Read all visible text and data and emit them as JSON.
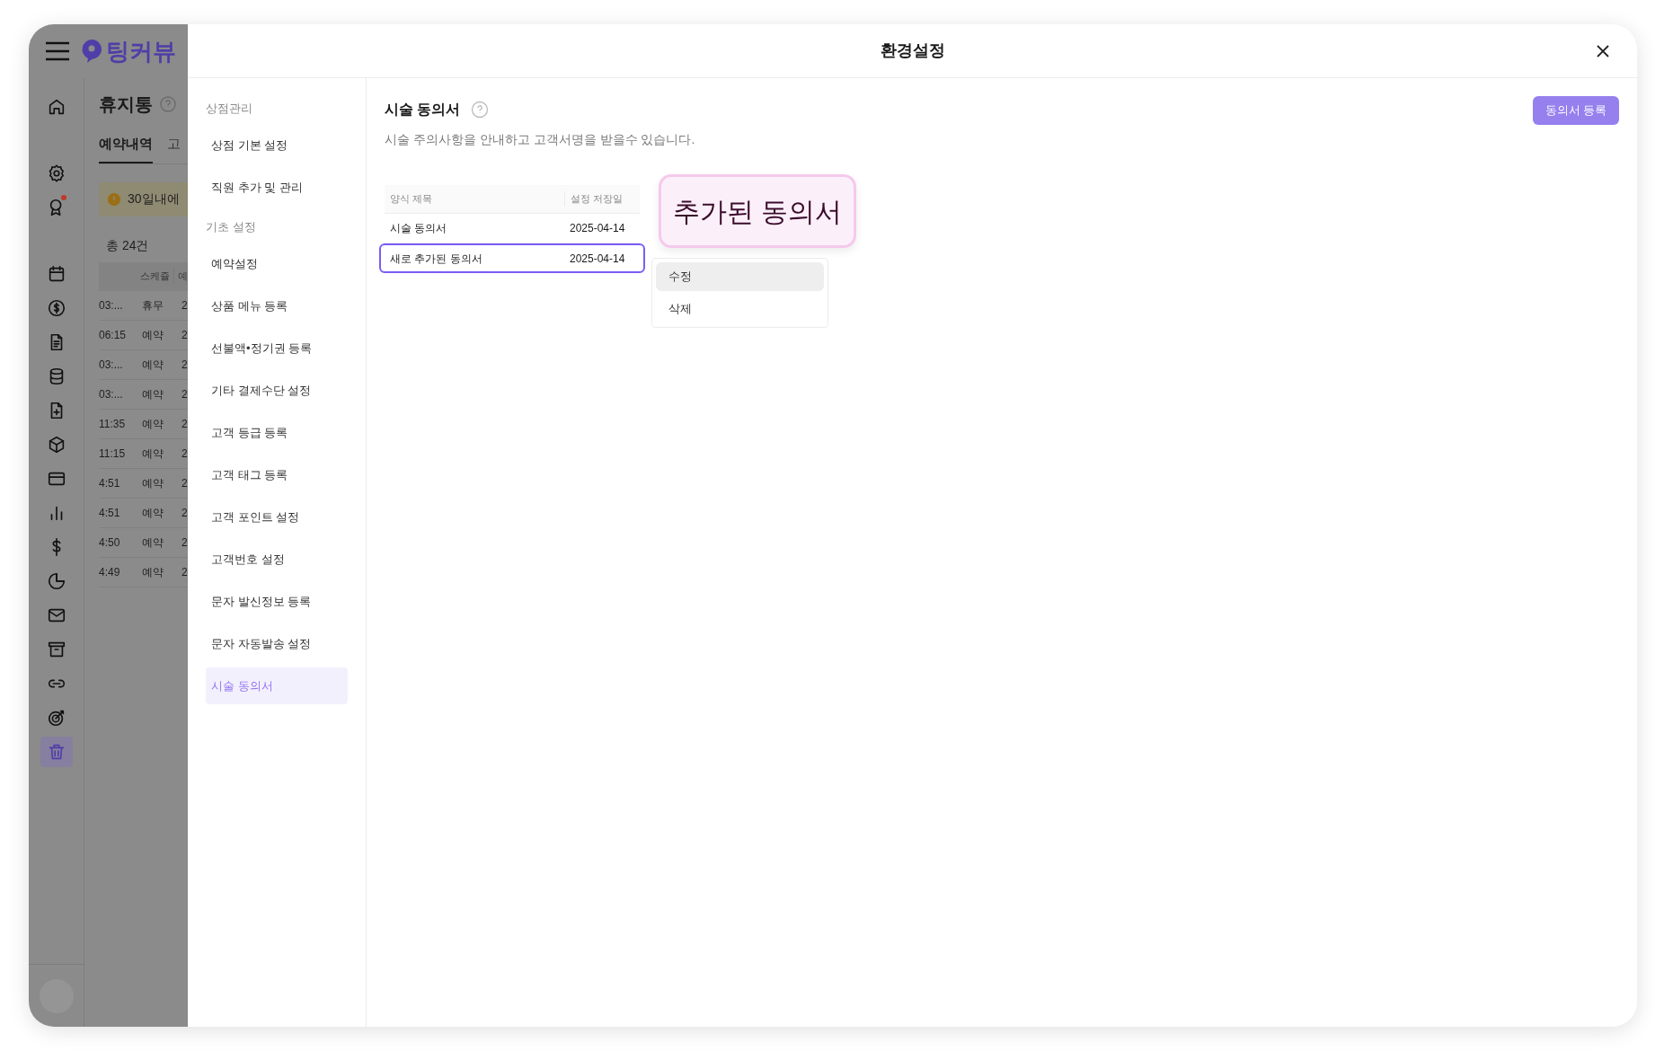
{
  "app": {
    "logo": "팅커뷰"
  },
  "rail": [
    {
      "kind": "home",
      "selected": false
    },
    {
      "kind": "gear",
      "selected": false
    },
    {
      "kind": "award",
      "selected": false,
      "badge": true
    },
    {
      "kind": "calendar",
      "selected": false
    },
    {
      "kind": "coin",
      "selected": false
    },
    {
      "kind": "document",
      "selected": false
    },
    {
      "kind": "database",
      "selected": false
    },
    {
      "kind": "file-plus",
      "selected": false
    },
    {
      "kind": "box",
      "selected": false
    },
    {
      "kind": "card",
      "selected": false
    },
    {
      "kind": "bars",
      "selected": false
    },
    {
      "kind": "dollar",
      "selected": false
    },
    {
      "kind": "pie",
      "selected": false
    },
    {
      "kind": "mail",
      "selected": false
    },
    {
      "kind": "archive",
      "selected": false
    },
    {
      "kind": "link",
      "selected": false
    },
    {
      "kind": "target",
      "selected": false
    },
    {
      "kind": "trash",
      "selected": true
    }
  ],
  "background_page": {
    "title": "휴지통",
    "tabs": [
      {
        "label": "예약내역",
        "selected": true
      },
      {
        "label": "고",
        "selected": false
      }
    ],
    "notice": "30일내에",
    "count": "총 24건",
    "columns": [
      "스케쥴",
      "예"
    ],
    "rows": [
      {
        "time": "03:...",
        "status": "휴무",
        "column_3": "2"
      },
      {
        "time": "06:15",
        "status": "예약",
        "column_3": "2"
      },
      {
        "time": "03:...",
        "status": "예약",
        "column_3": "2"
      },
      {
        "time": "03:...",
        "status": "예약",
        "column_3": "2"
      },
      {
        "time": "11:35",
        "status": "예약",
        "column_3": "2"
      },
      {
        "time": "11:15",
        "status": "예약",
        "column_3": "2"
      },
      {
        "time": "4:51",
        "status": "예약",
        "column_3": "2"
      },
      {
        "time": "4:51",
        "status": "예약",
        "column_3": "2"
      },
      {
        "time": "4:50",
        "status": "예약",
        "column_3": "2"
      },
      {
        "time": "4:49",
        "status": "예약",
        "column_3": "2"
      }
    ]
  },
  "modal": {
    "title": "환경설정"
  },
  "settings_nav": [
    {
      "heading": "상점관리",
      "items": [
        {
          "label": "상점 기본 설정",
          "selected": false
        },
        {
          "label": "직원 추가 및 관리",
          "selected": false
        }
      ]
    },
    {
      "heading": "기초 설정",
      "items": [
        {
          "label": "예약설정",
          "selected": false
        },
        {
          "label": "상품 메뉴 등록",
          "selected": false
        },
        {
          "label": "선불액•정기권 등록",
          "selected": false
        },
        {
          "label": "기타 결제수단 설정",
          "selected": false
        },
        {
          "label": "고객 등급 등록",
          "selected": false
        },
        {
          "label": "고객 태그 등록",
          "selected": false
        },
        {
          "label": "고객 포인트 설정",
          "selected": false
        },
        {
          "label": "고객번호 설정",
          "selected": false
        },
        {
          "label": "문자 발신정보 등록",
          "selected": false
        },
        {
          "label": "문자 자동발송 설정",
          "selected": false
        },
        {
          "label": "시술 동의서",
          "selected": true
        }
      ]
    }
  ],
  "content": {
    "title": "시술 동의서",
    "description": "시술 주의사항을 안내하고 고객서명을 받을수 있습니다.",
    "register_button": "동의서 등록",
    "table": {
      "columns": [
        "양식 제목",
        "설정 저장일"
      ],
      "rows": [
        {
          "title": "시술 동의서",
          "saved_date": "2025-04-14",
          "selected": false
        },
        {
          "title": "새로 추가된 동의서",
          "saved_date": "2025-04-14",
          "selected": true
        }
      ]
    },
    "callout": "추가된 동의서",
    "context_menu": [
      {
        "label": "수정",
        "selected": true
      },
      {
        "label": "삭제",
        "selected": false
      }
    ]
  }
}
